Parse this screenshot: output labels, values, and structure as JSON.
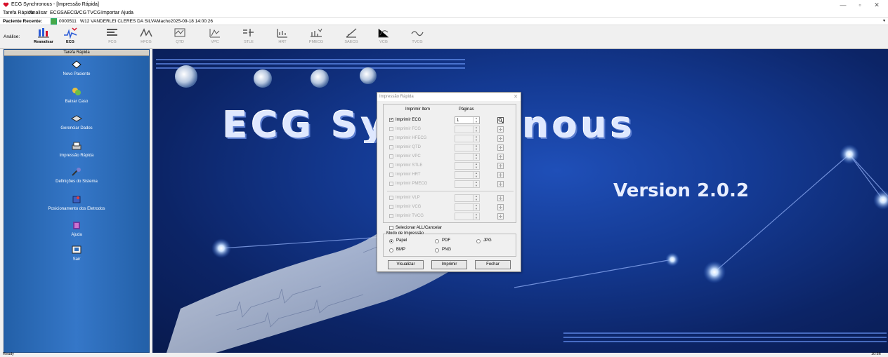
{
  "window": {
    "title": "ECG Synchronous - [Impressão Rápida]",
    "status": "Ready",
    "clock": "10:56"
  },
  "menu": [
    "Tarefa Rápida",
    "Analisar",
    "ECG",
    "SAECG",
    "VCG",
    "TVCG",
    "Importar",
    "Ajuda"
  ],
  "patient": {
    "label": "Paciente Recente:",
    "id": "0000511",
    "details": "W12 VANDERLEI CLERES DA SILVAMacho2025-09-18 14:00:26"
  },
  "toolbar": {
    "label": "Análise:",
    "tools": [
      {
        "label": "Reanalisar",
        "enabled": true
      },
      {
        "label": "ECG",
        "enabled": true
      },
      {
        "label": "FCG",
        "enabled": false
      },
      {
        "label": "HFCG",
        "enabled": false
      },
      {
        "label": "QTD",
        "enabled": false
      },
      {
        "label": "VPC",
        "enabled": false
      },
      {
        "label": "STLE",
        "enabled": false
      },
      {
        "label": "HRT",
        "enabled": false
      },
      {
        "label": "PMECG",
        "enabled": false
      },
      {
        "label": "SAECG",
        "enabled": false
      },
      {
        "label": "VCG",
        "enabled": false
      },
      {
        "label": "TVCG",
        "enabled": false
      }
    ]
  },
  "sidebar": {
    "header": "Tarefa Rápida",
    "items": [
      {
        "label": "Novo Paciente",
        "icon": "new-patient-icon"
      },
      {
        "label": "Baixar Caso",
        "icon": "download-case-icon"
      },
      {
        "label": "Gerenciar Dados",
        "icon": "manage-data-icon"
      },
      {
        "label": "Impressão Rápida",
        "icon": "print-icon"
      },
      {
        "label": "Definições do Sistema",
        "icon": "settings-icon"
      },
      {
        "label": "Posicionamento dos Eletrodos",
        "icon": "electrode-icon"
      },
      {
        "label": "Ajuda",
        "icon": "help-icon"
      },
      {
        "label": "Sair",
        "icon": "exit-icon"
      }
    ]
  },
  "splash": {
    "brand": "ECG Synchronous",
    "version": "Version 2.0.2"
  },
  "dialog": {
    "title": "Impressão Rápida",
    "col_item": "Imprimir Item",
    "col_pages": "Páginas",
    "items": [
      {
        "label": "Imprimir ECG",
        "checked": true,
        "enabled": true,
        "pages": "1"
      },
      {
        "label": "Imprimir FCG",
        "checked": false,
        "enabled": false,
        "pages": ""
      },
      {
        "label": "Imprimir HFECG",
        "checked": false,
        "enabled": false,
        "pages": ""
      },
      {
        "label": "Imprimir QTD",
        "checked": false,
        "enabled": false,
        "pages": ""
      },
      {
        "label": "Imprimir VPC",
        "checked": false,
        "enabled": false,
        "pages": ""
      },
      {
        "label": "Imprimir STLE",
        "checked": false,
        "enabled": false,
        "pages": ""
      },
      {
        "label": "Imprimir HRT",
        "checked": false,
        "enabled": false,
        "pages": ""
      },
      {
        "label": "Imprimir PMECG",
        "checked": false,
        "enabled": false,
        "pages": ""
      },
      {
        "label": "Imprimir VLP",
        "checked": false,
        "enabled": false,
        "pages": ""
      },
      {
        "label": "Imprimir VCG",
        "checked": false,
        "enabled": false,
        "pages": ""
      },
      {
        "label": "Imprimir TVCG",
        "checked": false,
        "enabled": false,
        "pages": ""
      }
    ],
    "select_all": "Selecionar ALL/Cancelar",
    "mode_label": "Modo de Impressão",
    "modes": [
      {
        "label": "Papel",
        "selected": true
      },
      {
        "label": "PDF",
        "selected": false
      },
      {
        "label": "JPG",
        "selected": false
      },
      {
        "label": "BMP",
        "selected": false
      },
      {
        "label": "PNG",
        "selected": false
      }
    ],
    "buttons": {
      "preview": "Visualizar",
      "print": "Imprimir",
      "close": "Fechar"
    }
  },
  "colors": {
    "sidebar": "#2f6fbd",
    "splash_bg": "#143a93",
    "accent": "#d7102a"
  }
}
